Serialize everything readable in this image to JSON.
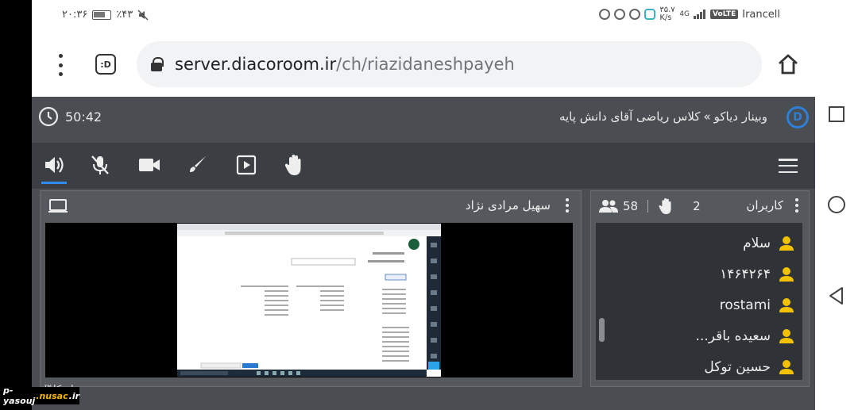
{
  "status_bar": {
    "time": "۲۰:۳۶",
    "battery_percent": "٪۴۳",
    "speed": "۳۵.۷ K/s",
    "volte": "VoLTE",
    "network_type": "4G",
    "carrier": "Irancell"
  },
  "browser": {
    "url_host": "server.diacoroom.ir",
    "url_path": "/ch/riazidaneshpayeh",
    "tab_icon_label": ":D"
  },
  "app": {
    "timer": "50:42",
    "breadcrumb_root": "وبینار دیاکو",
    "breadcrumb_sep": "»",
    "room_title": "کلاس ریاضی آقای دانش پایه",
    "logo_letter": "D",
    "toolbar": {
      "icons": [
        "speaker-icon",
        "mic-muted-icon",
        "camera-icon",
        "brush-icon",
        "play-icon",
        "hand-icon"
      ],
      "active_index": 0
    },
    "video_panel": {
      "presenter_name": "سهیل مرادی نژاد"
    },
    "users_panel": {
      "title": "کاربران",
      "users_count": "58",
      "raised_hands": "2",
      "users": [
        {
          "name": "سلام"
        },
        {
          "name": "۱۴۶۴۲۶۴"
        },
        {
          "name": "rostami"
        },
        {
          "name": "سعیده باقر..."
        },
        {
          "name": "حسین توکل"
        }
      ]
    },
    "footer_text": "اسکا™"
  },
  "watermark": {
    "prefix": "p-yasouj",
    "highlight": ".nusac",
    "suffix": ".ir"
  },
  "colors": {
    "accent": "#2f8bf0",
    "user_icon": "#f2c200",
    "app_bg": "#4a4d52"
  }
}
